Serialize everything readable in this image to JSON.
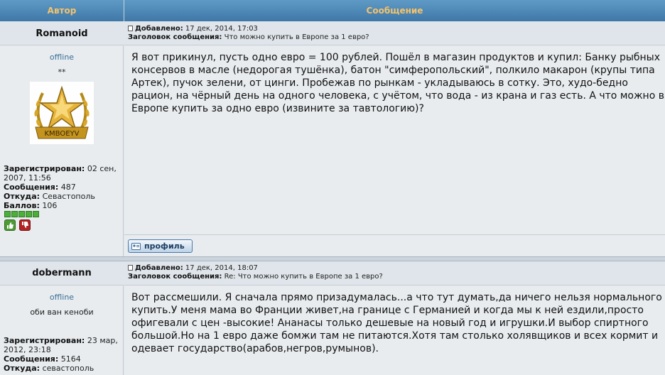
{
  "header": {
    "author_col": "Автор",
    "message_col": "Сообщение"
  },
  "posts": [
    {
      "author": "Romanoid",
      "meta": {
        "added_label": "Добавлено:",
        "added_value": "17 дек, 2014, 17:03",
        "subject_label": "Заголовок сообщения:",
        "subject_value": "Что можно купить в Европе за 1 евро?"
      },
      "status": "offline",
      "rank": "**",
      "registered_label": "Зарегистрирован:",
      "registered_value": "02 сен, 2007, 11:56",
      "posts_label": "Сообщения:",
      "posts_value": "487",
      "from_label": "Откуда:",
      "from_value": "Севастополь",
      "points_label": "Баллов:",
      "points_value": "106",
      "body": "Я вот прикинул, пусть одно евро = 100 рублей. Пошёл в магазин продуктов и купил: Банку рыбных консервов в масле (недорогая тушёнка), батон \"симферопольский\", полкило макарон (крупы типа Артек), пучок зелени, от цинги. Пробежав по рынкам - укладываюсь в сотку. Это, худо-бедно рацион, на чёрный день на одного человека, с учётом, что вода - из крана и газ есть. А что можно в Европе купить за одно евро (извините за тавтологию)?",
      "profile_button": "профиль",
      "avatar_text": "KMBOEYV"
    },
    {
      "author": "dobermann",
      "meta": {
        "added_label": "Добавлено:",
        "added_value": "17 дек, 2014, 18:07",
        "subject_label": "Заголовок сообщения:",
        "subject_value": "Re: Что можно купить в Европе за 1 евро?"
      },
      "status": "offline",
      "rank": "оби ван кеноби",
      "registered_label": "Зарегистрирован:",
      "registered_value": "23 мар, 2012, 23:18",
      "posts_label": "Сообщения:",
      "posts_value": "5164",
      "from_label": "Откуда:",
      "from_value": "севастополь",
      "body": "Вот рассмешили. Я сначала прямо призадумалась...а что тут думать,да ничего нельзя нормального купить.У меня мама во Франции живет,на границе с Германией и когда мы к ней ездили,просто офигевали с цен -высокие! Ананасы только дешевые на новый год и игрушки.И выбор спиртного большой.Но на 1 евро даже бомжи там не питаются.Хотя там столько холявщиков и всех кормит и одевает государство(арабов,негров,румынов)."
    }
  ]
}
